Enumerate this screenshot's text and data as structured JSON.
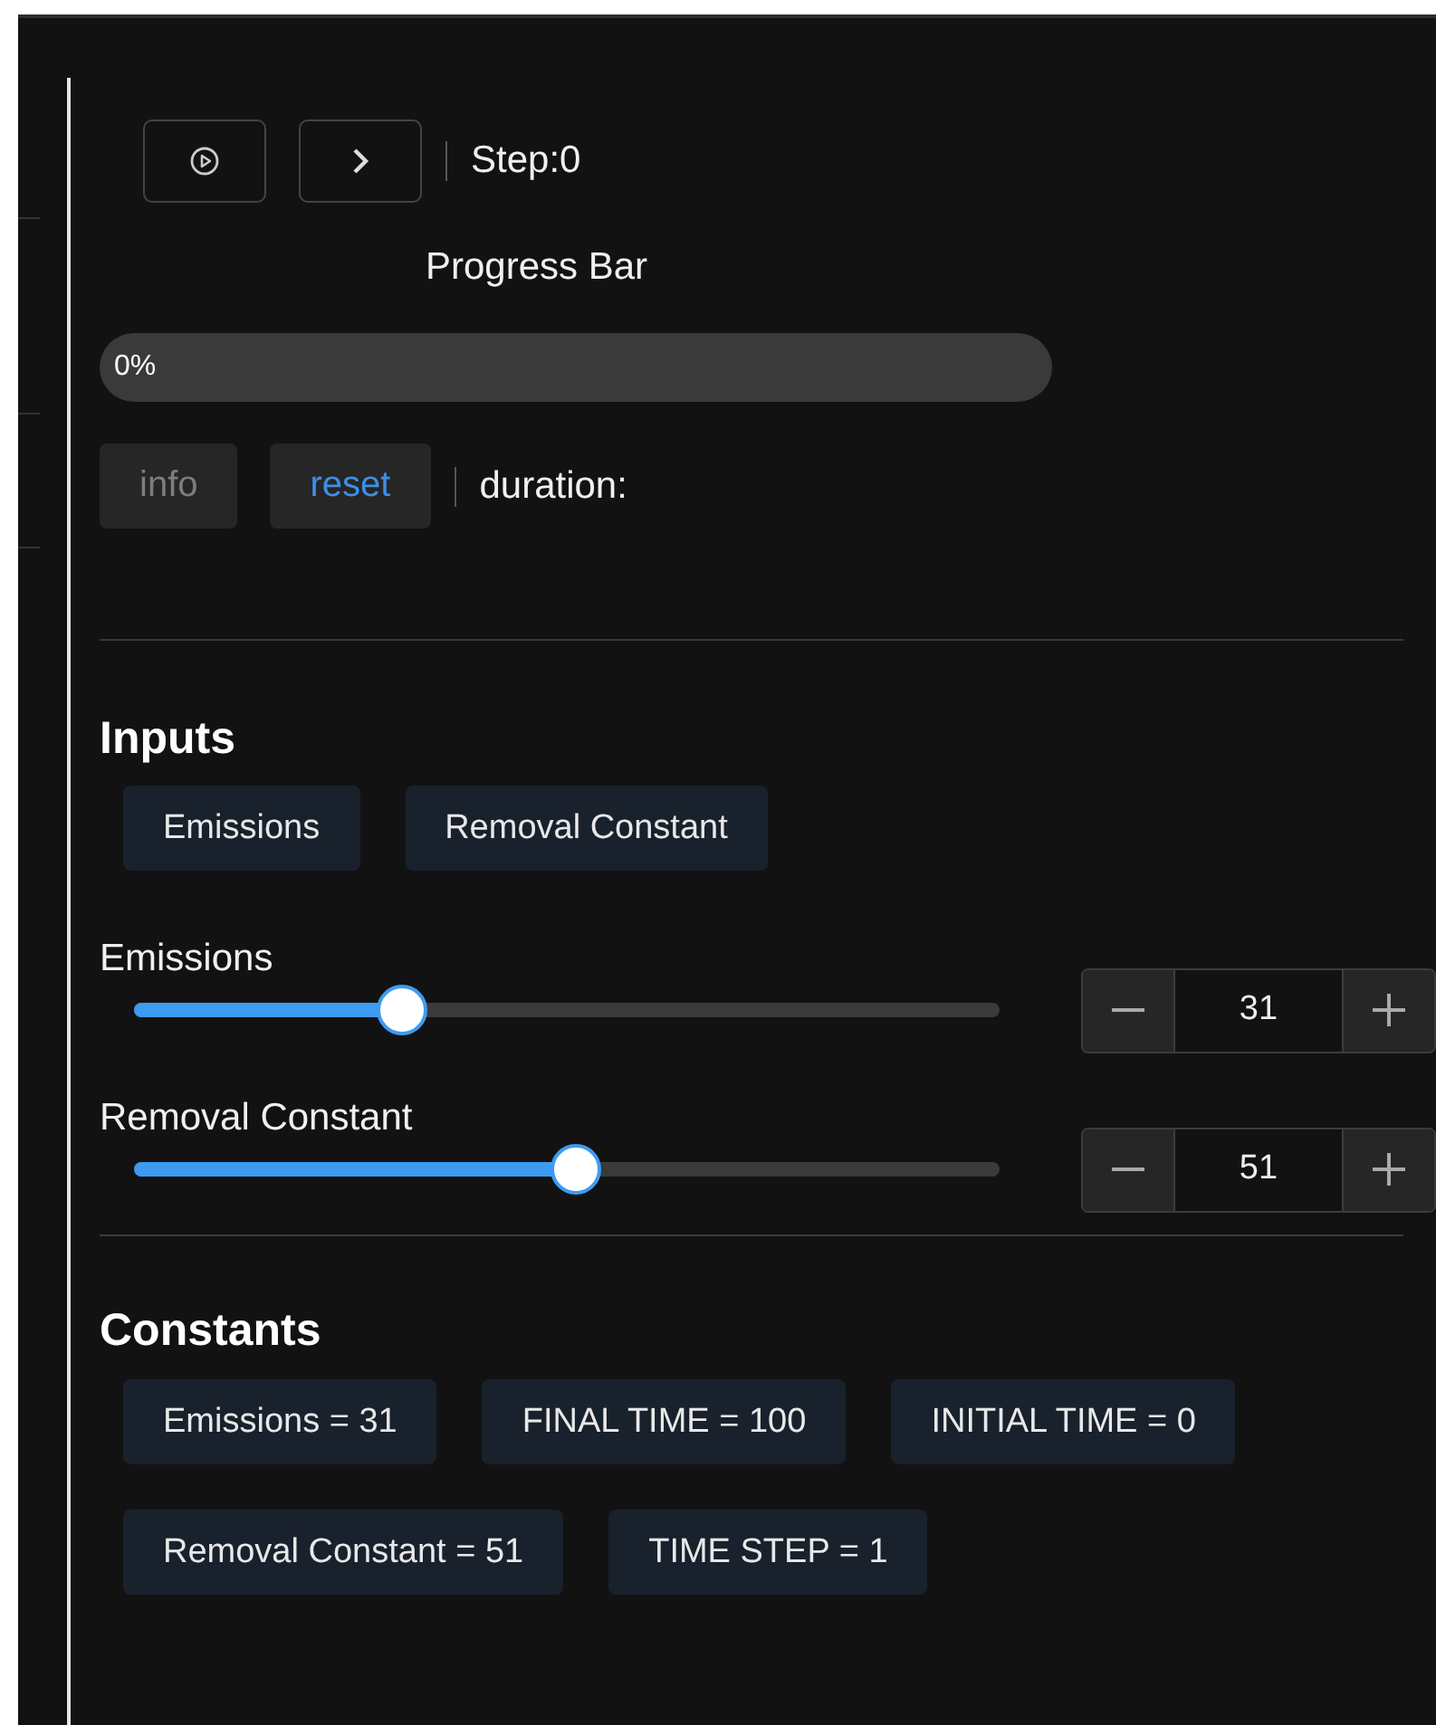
{
  "toolbar": {
    "step_label": "Step:0"
  },
  "progress": {
    "title": "Progress Bar",
    "level": 0,
    "reading": "0%"
  },
  "actions": [
    {
      "label": "info",
      "disabled": true
    },
    {
      "label": "reset",
      "disabled": false
    }
  ],
  "duration_label": "duration:",
  "inputs": {
    "title": "Inputs",
    "tabs": [
      "Emissions",
      "Removal Constant"
    ],
    "sliders": [
      {
        "label": "Emissions",
        "level": 0.31,
        "value": "31"
      },
      {
        "label": "Removal Constant",
        "level": 0.51,
        "value": "51"
      }
    ]
  },
  "constants": {
    "title": "Constants",
    "items": [
      "Emissions = 31",
      "FINAL TIME = 100",
      "INITIAL TIME = 0",
      "Removal Constant = 51",
      "TIME STEP = 1"
    ]
  }
}
